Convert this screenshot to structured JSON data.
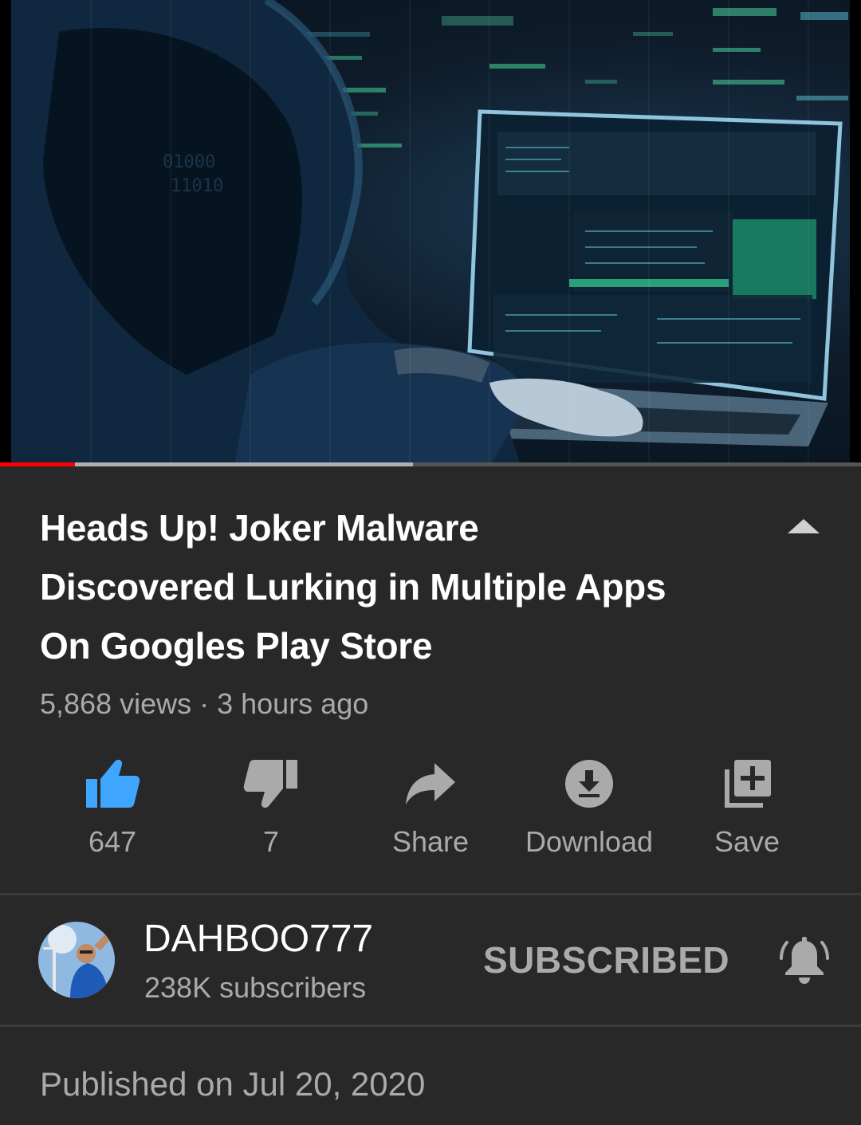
{
  "video": {
    "thumbnail_icon": "hooded-hacker-at-laptop-image",
    "progress_played": 0.087,
    "progress_buffered": 0.48
  },
  "title": {
    "line1": "Heads Up! Joker Malware",
    "line2": "Discovered Lurking in Multiple Apps",
    "line3": "On Googles Play Store",
    "collapse_icon": "chevron-up-icon"
  },
  "meta": {
    "views": "5,868 views",
    "separator": " · ",
    "age": "3 hours ago"
  },
  "actions": {
    "like": {
      "icon": "thumbs-up-icon",
      "label": "647"
    },
    "dislike": {
      "icon": "thumbs-down-icon",
      "label": "7"
    },
    "share": {
      "icon": "share-arrow-icon",
      "label": "Share"
    },
    "download": {
      "icon": "download-icon",
      "label": "Download"
    },
    "save": {
      "icon": "add-to-playlist-icon",
      "label": "Save"
    }
  },
  "channel": {
    "name": "DAHBOO777",
    "subscribers": "238K subscribers",
    "subscribe_label": "SUBSCRIBED",
    "bell_icon": "notification-bell-icon",
    "avatar_icon": "channel-avatar"
  },
  "description": {
    "published": "Published on Jul 20, 2020"
  },
  "colors": {
    "background": "#282828",
    "text_primary": "#ffffff",
    "text_secondary": "#aaaaaa",
    "like_active": "#3ea6ff",
    "progress_red": "#ff0000",
    "divider": "#3a3a3a"
  }
}
